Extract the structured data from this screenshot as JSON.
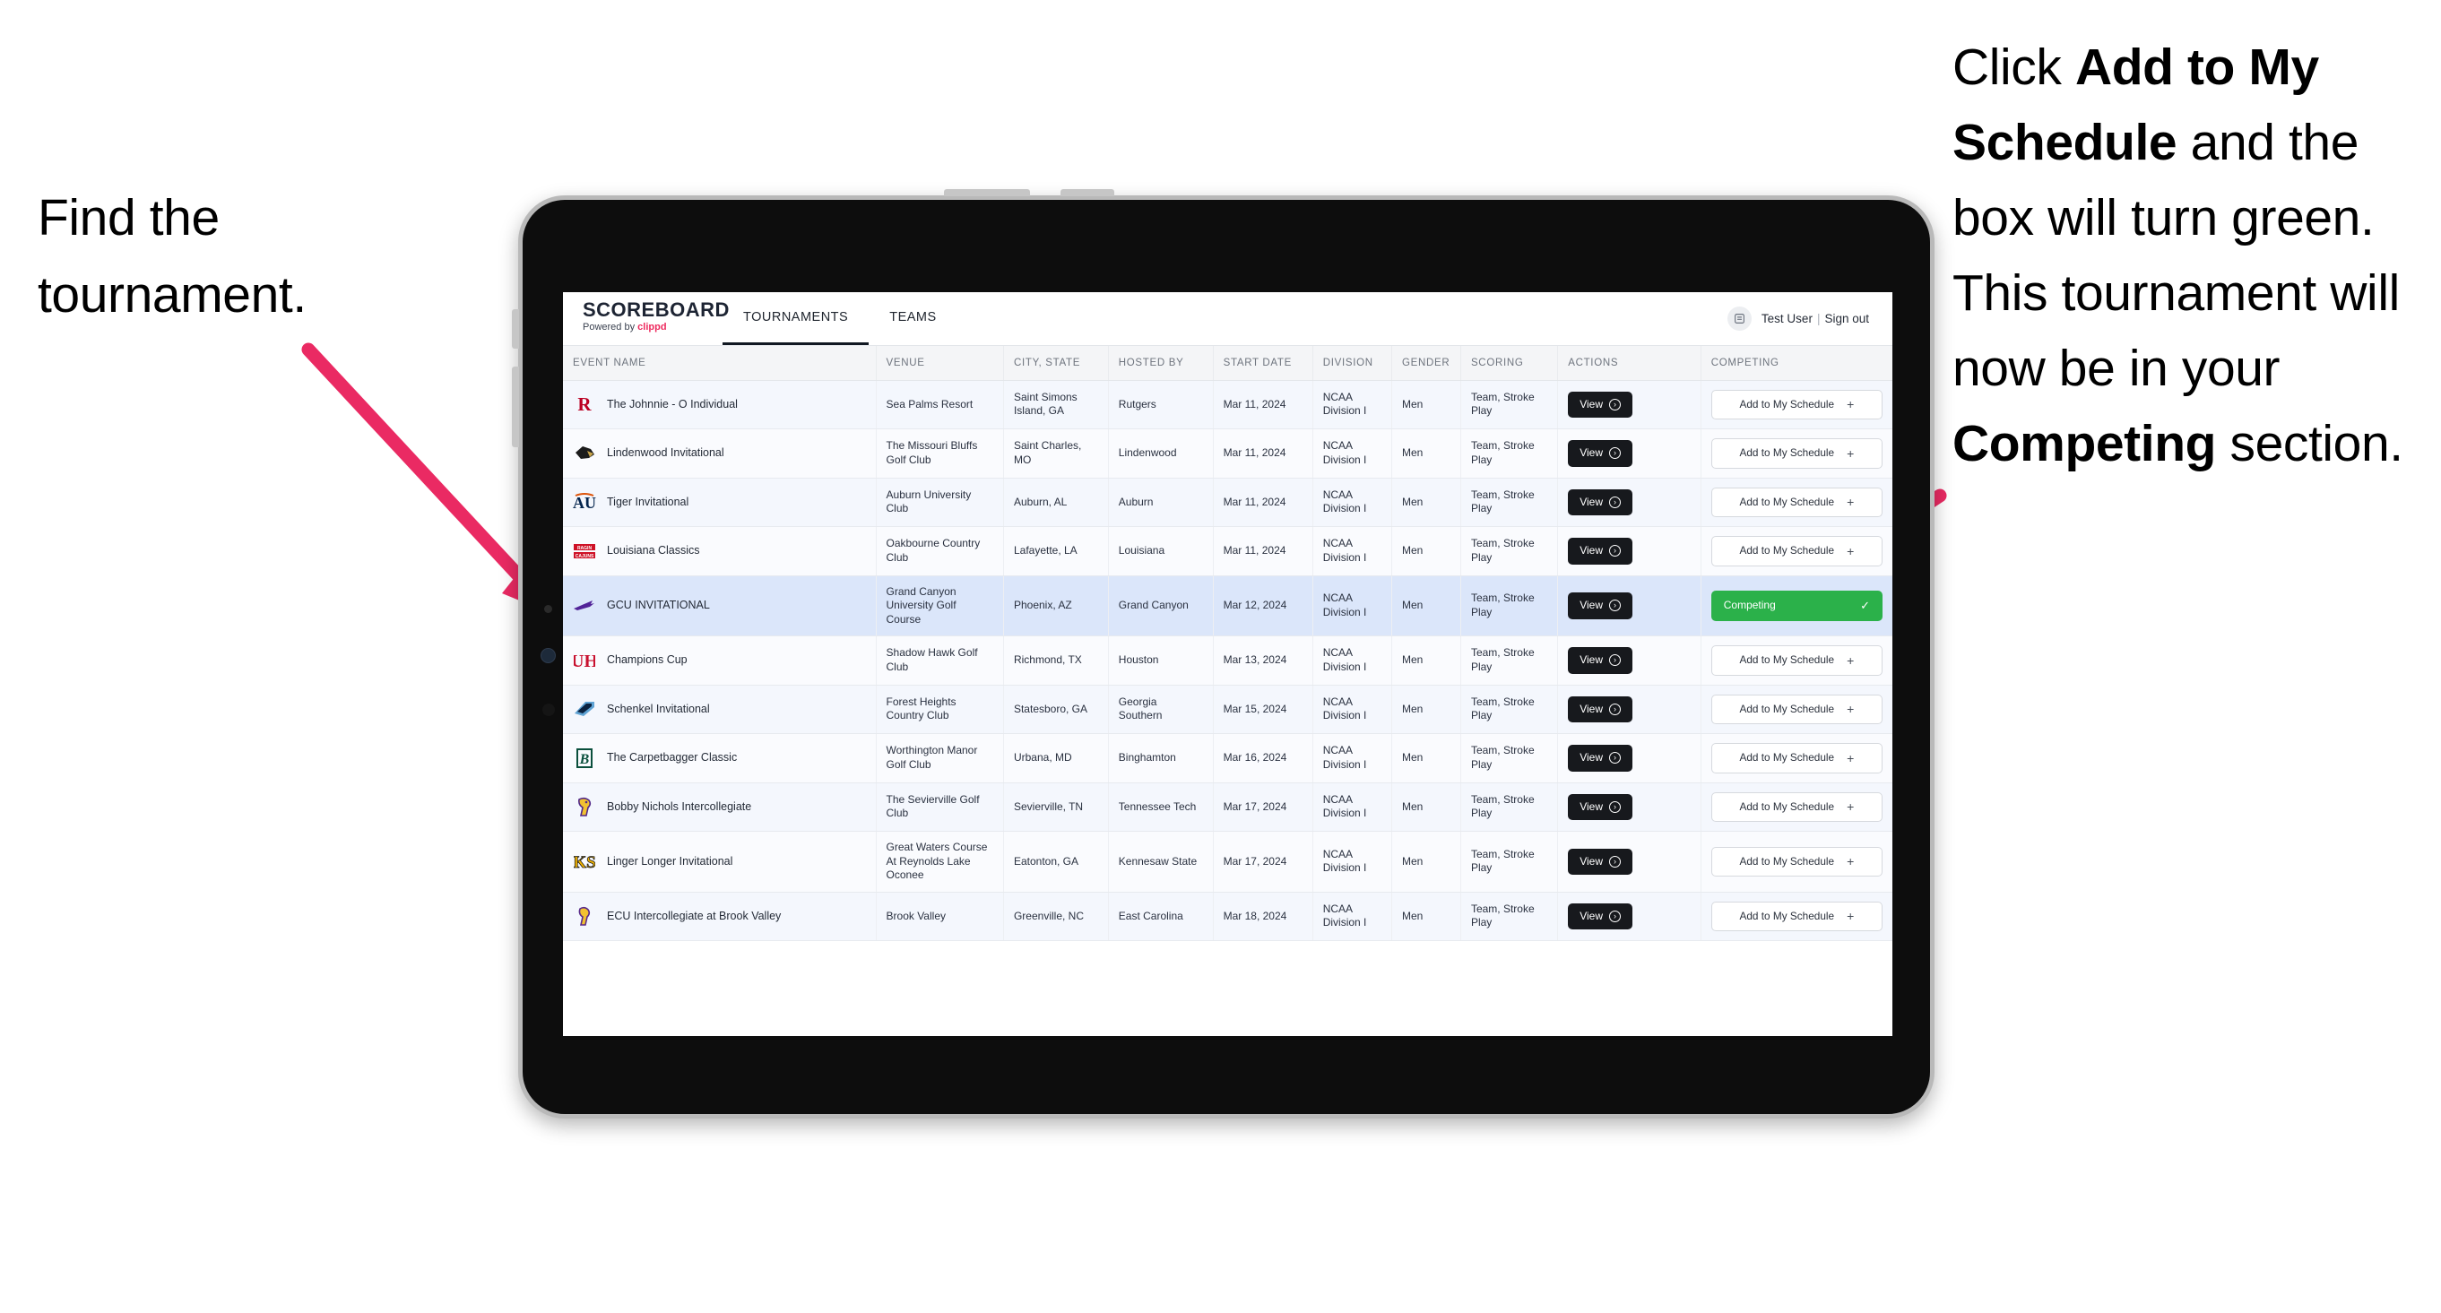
{
  "annotations": {
    "left": {
      "line1": "Find the",
      "line2": "tournament."
    },
    "right": {
      "p1_a": "Click ",
      "p1_b": "Add to My Schedule",
      "p1_c": " and the box will turn green. This tournament will now be in your ",
      "p1_d": "Competing",
      "p1_e": " section."
    },
    "arrow_color": "#ea2a63"
  },
  "app": {
    "brand": {
      "title": "SCOREBOARD",
      "powered_prefix": "Powered by ",
      "powered_name": "clippd"
    },
    "nav_tabs": [
      {
        "label": "TOURNAMENTS",
        "active": true
      },
      {
        "label": "TEAMS",
        "active": false
      }
    ],
    "user": {
      "avatar_icon": "user-avatar-icon",
      "name": "Test User",
      "separator": "|",
      "sign_out": "Sign out"
    },
    "table": {
      "columns": [
        "EVENT NAME",
        "VENUE",
        "CITY, STATE",
        "HOSTED BY",
        "START DATE",
        "DIVISION",
        "GENDER",
        "SCORING",
        "ACTIONS",
        "COMPETING"
      ],
      "buttons": {
        "view": "View",
        "view_icon": "arrow-right-circle-icon",
        "add": "Add to My Schedule",
        "add_icon": "plus-icon",
        "competing": "Competing",
        "competing_icon": "check-icon",
        "competing_color": "#2bb14a"
      },
      "rows": [
        {
          "logo": "rutgers-logo",
          "event": "The Johnnie - O Individual",
          "venue": "Sea Palms Resort",
          "city": "Saint Simons Island, GA",
          "hosted_by": "Rutgers",
          "start_date": "Mar 11, 2024",
          "division": "NCAA Division I",
          "gender": "Men",
          "scoring": "Team, Stroke Play",
          "competing": false
        },
        {
          "logo": "lindenwood-logo",
          "event": "Lindenwood Invitational",
          "venue": "The Missouri Bluffs Golf Club",
          "city": "Saint Charles, MO",
          "hosted_by": "Lindenwood",
          "start_date": "Mar 11, 2024",
          "division": "NCAA Division I",
          "gender": "Men",
          "scoring": "Team, Stroke Play",
          "competing": false
        },
        {
          "logo": "auburn-logo",
          "event": "Tiger Invitational",
          "venue": "Auburn University Club",
          "city": "Auburn, AL",
          "hosted_by": "Auburn",
          "start_date": "Mar 11, 2024",
          "division": "NCAA Division I",
          "gender": "Men",
          "scoring": "Team, Stroke Play",
          "competing": false
        },
        {
          "logo": "louisiana-logo",
          "event": "Louisiana Classics",
          "venue": "Oakbourne Country Club",
          "city": "Lafayette, LA",
          "hosted_by": "Louisiana",
          "start_date": "Mar 11, 2024",
          "division": "NCAA Division I",
          "gender": "Men",
          "scoring": "Team, Stroke Play",
          "competing": false
        },
        {
          "logo": "gcu-logo",
          "event": "GCU INVITATIONAL",
          "venue": "Grand Canyon University Golf Course",
          "city": "Phoenix, AZ",
          "hosted_by": "Grand Canyon",
          "start_date": "Mar 12, 2024",
          "division": "NCAA Division I",
          "gender": "Men",
          "scoring": "Team, Stroke Play",
          "competing": true,
          "selected": true
        },
        {
          "logo": "houston-logo",
          "event": "Champions Cup",
          "venue": "Shadow Hawk Golf Club",
          "city": "Richmond, TX",
          "hosted_by": "Houston",
          "start_date": "Mar 13, 2024",
          "division": "NCAA Division I",
          "gender": "Men",
          "scoring": "Team, Stroke Play",
          "competing": false
        },
        {
          "logo": "georgia-southern-logo",
          "event": "Schenkel Invitational",
          "venue": "Forest Heights Country Club",
          "city": "Statesboro, GA",
          "hosted_by": "Georgia Southern",
          "start_date": "Mar 15, 2024",
          "division": "NCAA Division I",
          "gender": "Men",
          "scoring": "Team, Stroke Play",
          "competing": false
        },
        {
          "logo": "binghamton-logo",
          "event": "The Carpetbagger Classic",
          "venue": "Worthington Manor Golf Club",
          "city": "Urbana, MD",
          "hosted_by": "Binghamton",
          "start_date": "Mar 16, 2024",
          "division": "NCAA Division I",
          "gender": "Men",
          "scoring": "Team, Stroke Play",
          "competing": false
        },
        {
          "logo": "tennessee-tech-logo",
          "event": "Bobby Nichols Intercollegiate",
          "venue": "The Sevierville Golf Club",
          "city": "Sevierville, TN",
          "hosted_by": "Tennessee Tech",
          "start_date": "Mar 17, 2024",
          "division": "NCAA Division I",
          "gender": "Men",
          "scoring": "Team, Stroke Play",
          "competing": false
        },
        {
          "logo": "kennesaw-state-logo",
          "event": "Linger Longer Invitational",
          "venue": "Great Waters Course At Reynolds Lake Oconee",
          "city": "Eatonton, GA",
          "hosted_by": "Kennesaw State",
          "start_date": "Mar 17, 2024",
          "division": "NCAA Division I",
          "gender": "Men",
          "scoring": "Team, Stroke Play",
          "competing": false
        },
        {
          "logo": "east-carolina-logo",
          "event": "ECU Intercollegiate at Brook Valley",
          "venue": "Brook Valley",
          "city": "Greenville, NC",
          "hosted_by": "East Carolina",
          "start_date": "Mar 18, 2024",
          "division": "NCAA Division I",
          "gender": "Men",
          "scoring": "Team, Stroke Play",
          "competing": false
        }
      ]
    }
  }
}
